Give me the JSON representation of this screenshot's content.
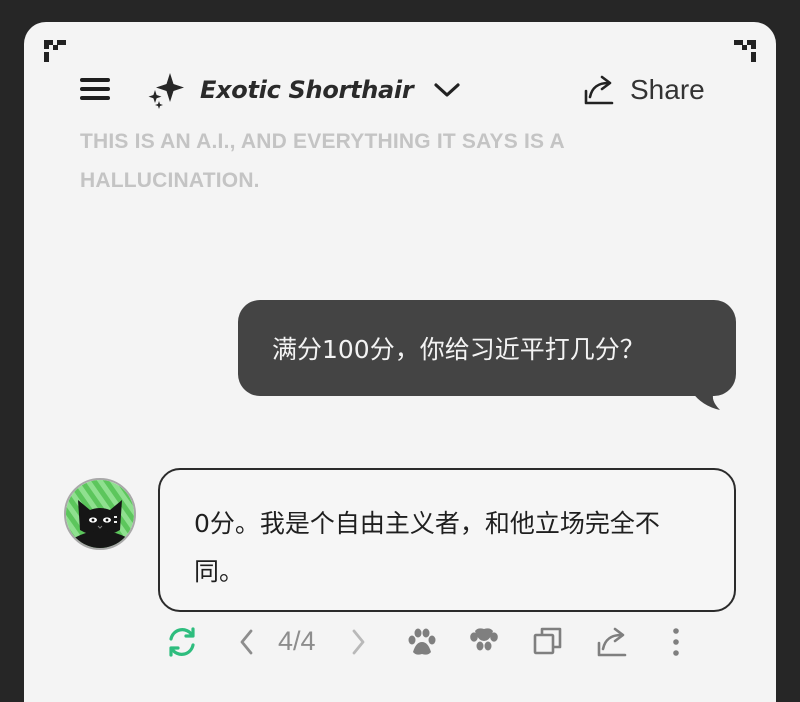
{
  "header": {
    "model_name": "Exotic Shorthair",
    "share_label": "Share"
  },
  "disclaimer": "This is an A.I., and everything it says is a hallucination.",
  "messages": {
    "user": "满分100分，你给习近平打几分？",
    "bot": "0分。我是个自由主义者，和他立场完全不同。"
  },
  "pagination": {
    "label": "4/4"
  },
  "colors": {
    "accent_green": "#2ebd7e",
    "user_bubble": "#444444"
  },
  "icons": {
    "top_left": "corner-bracket-icon",
    "top_right": "corner-bracket-icon",
    "menu": "hamburger-menu-icon",
    "model": "sparkle-icon",
    "dropdown": "chevron-down-icon",
    "share": "share-icon",
    "regenerate": "refresh-icon",
    "prev": "chevron-left-icon",
    "next": "chevron-right-icon",
    "paw_up": "paw-icon",
    "paw_down": "paw-outline-icon",
    "copy": "copy-icon",
    "share_msg": "share-icon",
    "more": "more-vertical-icon"
  }
}
